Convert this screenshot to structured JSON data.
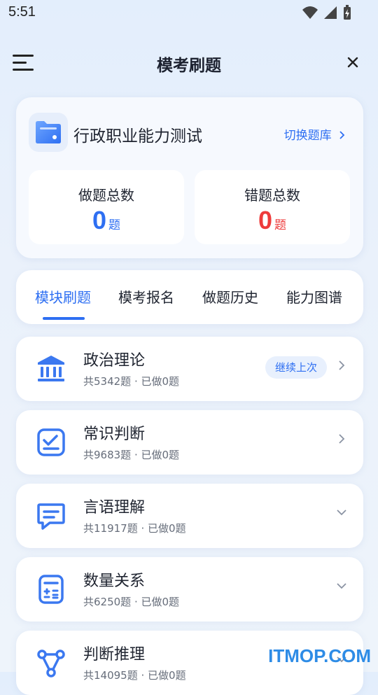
{
  "status_bar": {
    "time": "5:51"
  },
  "header": {
    "title": "模考刷题"
  },
  "question_bank": {
    "name": "行政职业能力测试",
    "switch_label": "切换题库",
    "stats": [
      {
        "label": "做题总数",
        "value": "0",
        "unit": "题",
        "color": "#2e6ff2"
      },
      {
        "label": "错题总数",
        "value": "0",
        "unit": "题",
        "color": "#ee3b3b"
      }
    ]
  },
  "tabs": [
    {
      "label": "模块刷题",
      "active": true
    },
    {
      "label": "模考报名",
      "active": false
    },
    {
      "label": "做题历史",
      "active": false
    },
    {
      "label": "能力图谱",
      "active": false
    }
  ],
  "modules": [
    {
      "title": "政治理论",
      "subtitle": "共5342题 · 已做0题",
      "badge": "继续上次",
      "icon": "bank-building-icon",
      "chevron": "right"
    },
    {
      "title": "常识判断",
      "subtitle": "共9683题 · 已做0题",
      "icon": "checklist-icon",
      "chevron": "right"
    },
    {
      "title": "言语理解",
      "subtitle": "共11917题 · 已做0题",
      "icon": "chat-bubble-icon",
      "chevron": "down"
    },
    {
      "title": "数量关系",
      "subtitle": "共6250题 · 已做0题",
      "icon": "calculator-icon",
      "chevron": "down"
    },
    {
      "title": "判断推理",
      "subtitle": "共14095题 · 已做0题",
      "icon": "network-nodes-icon",
      "chevron": "down"
    }
  ],
  "watermark": "ITMOP.COM",
  "colors": {
    "accent": "#2e6ff2",
    "error": "#ee3b3b"
  }
}
